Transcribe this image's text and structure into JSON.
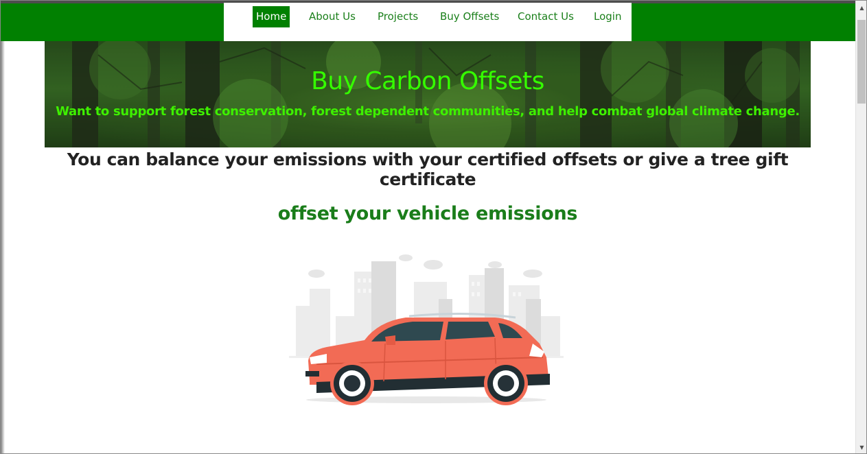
{
  "nav": {
    "items": [
      {
        "label": "Home",
        "active": true
      },
      {
        "label": "About Us",
        "active": false
      },
      {
        "label": "Projects",
        "active": false
      },
      {
        "label": "Buy Offsets",
        "active": false
      },
      {
        "label": "Contact Us",
        "active": false
      },
      {
        "label": "Login",
        "active": false
      }
    ]
  },
  "hero": {
    "title": "Buy Carbon Offsets",
    "subtitle": "Want to support forest conservation, forest dependent communities, and help combat global climate change."
  },
  "main": {
    "headline": "You can balance your emissions with your certified offsets or give a tree gift certificate",
    "section_title": "offset your vehicle emissions"
  },
  "illustration": {
    "subject": "car-city-illustration"
  },
  "colors": {
    "brand_green": "#018001",
    "hero_text_green": "#35ff00",
    "section_green": "#1a7d1a",
    "car": "#f26b55"
  },
  "scrollbar": {
    "up_icon": "scroll-up-arrow-icon",
    "down_icon": "scroll-down-arrow-icon"
  }
}
